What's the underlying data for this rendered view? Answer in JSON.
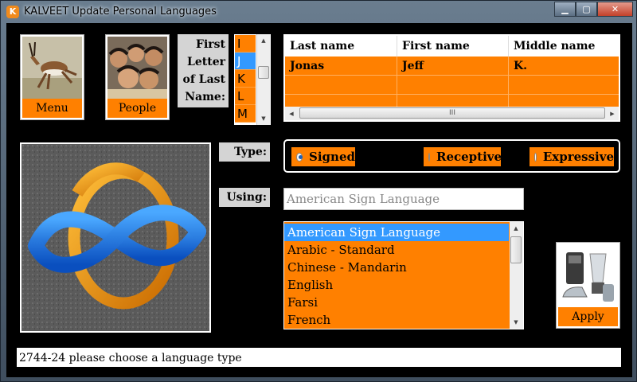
{
  "window": {
    "title": "KALVEET Update Personal Languages",
    "app_icon_letter": "K",
    "minimize": "▁",
    "maximize": "▢",
    "close": "✕"
  },
  "nav": {
    "menu_label": "Menu",
    "people_label": "People"
  },
  "letter_filter": {
    "label_lines": [
      "First",
      "Letter",
      "of Last",
      "Name:"
    ],
    "letters": [
      "I",
      "J",
      "K",
      "L",
      "M"
    ],
    "selected": "J"
  },
  "name_grid": {
    "columns": [
      "Last name",
      "First name",
      "Middle name"
    ],
    "rows": [
      [
        "Jonas",
        "Jeff",
        "K."
      ],
      [
        "",
        "",
        ""
      ],
      [
        "",
        "",
        ""
      ]
    ],
    "scroll_grip": "III"
  },
  "type": {
    "label": "Type:",
    "options": [
      {
        "label": "Signed",
        "selected": true
      },
      {
        "label": "Receptive",
        "selected": false
      },
      {
        "label": "Expressive",
        "selected": false
      }
    ]
  },
  "using": {
    "label": "Using:",
    "value": "American Sign Language"
  },
  "languages": {
    "items": [
      "American Sign Language",
      "Arabic - Standard",
      "Chinese - Mandarin",
      "English",
      "Farsi",
      "French"
    ],
    "selected": "American Sign Language"
  },
  "apply_label": "Apply",
  "status": "2744-24 please choose a language type",
  "colors": {
    "accent": "#ff8000",
    "selection": "#3399ff",
    "background": "#000000",
    "label_bg": "#d4d4d4"
  }
}
